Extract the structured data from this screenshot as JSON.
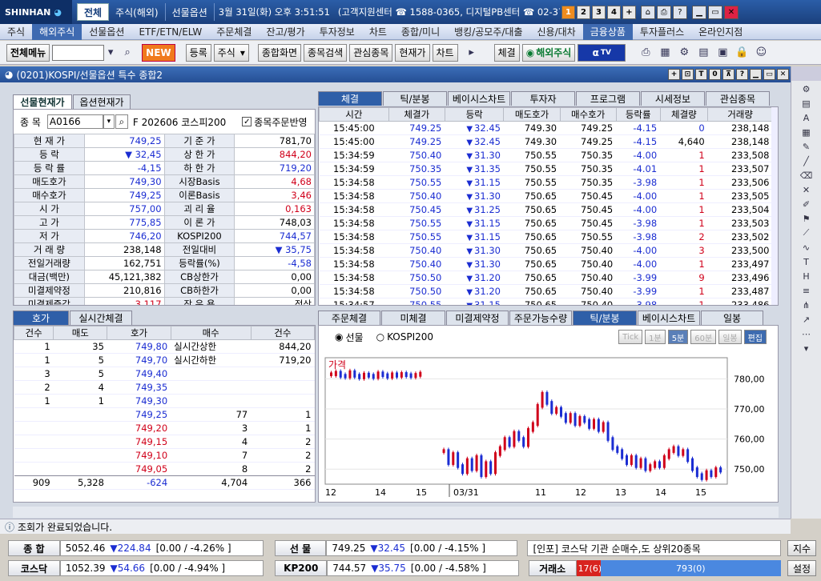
{
  "titlebar": {
    "logo": "SHINHAN",
    "tabs": [
      "전체",
      "주식(해외)",
      "선물옵션"
    ],
    "datetime": "3월 31일(화) 오후 3:51:51",
    "center": "(고객지원센터 ☎ 1588-0365, 디지털PB센터 ☎ 02-3772-",
    "nums": [
      "1",
      "2",
      "3",
      "4",
      "+"
    ]
  },
  "menu": [
    "주식",
    "해외주식",
    "선물옵션",
    "ETF/ETN/ELW",
    "주문체결",
    "잔고/평가",
    "투자정보",
    "차트",
    "종합/미니",
    "뱅킹/공모주/대출",
    "신용/대차",
    "금융상품",
    "투자플러스",
    "온라인지점"
  ],
  "toolbar": {
    "allmenu": "전체메뉴",
    "new": "NEW",
    "register": "등록",
    "type": "주식",
    "b1": "종합화면",
    "b2": "종목검색",
    "b3": "관심종목",
    "b4": "현재가",
    "b5": "차트",
    "b6": "체결",
    "overseas": "해외주식",
    "tv": "TV"
  },
  "window": {
    "title": "(0201)KOSPI/선물옵션 특수 종합2"
  },
  "left": {
    "tabs": [
      "선물현재가",
      "옵션현재가"
    ],
    "code_label": "종 목",
    "code": "A0166",
    "desc": "F 202606 코스피200",
    "check_label": "종목주문반영",
    "rows": [
      {
        "l1": "현 재 가",
        "v1": "749,25",
        "l2": "기 준 가",
        "v2": "781,70"
      },
      {
        "l1": "등    락",
        "v1": "32,45",
        "l2": "상 한 가",
        "v2": "844,20"
      },
      {
        "l1": "등 락 률",
        "v1": "-4,15",
        "l2": "하 한 가",
        "v2": "719,20"
      },
      {
        "l1": "매도호가",
        "v1": "749,30",
        "l2": "시장Basis",
        "v2": "4,68"
      },
      {
        "l1": "매수호가",
        "v1": "749,25",
        "l2": "이론Basis",
        "v2": "3,46"
      },
      {
        "l1": "시    가",
        "v1": "757,00",
        "l2": "괴 리 율",
        "v2": "0,163"
      },
      {
        "l1": "고    가",
        "v1": "775,85",
        "l2": "이 론 가",
        "v2": "748,03"
      },
      {
        "l1": "저    가",
        "v1": "746,20",
        "l2": "KOSPI200",
        "v2": "744,57"
      },
      {
        "l1": "거 래 량",
        "v1": "238,148",
        "l2": "전일대비",
        "v2": "35,75"
      },
      {
        "l1": "전일거래량",
        "v1": "162,751",
        "l2": "등락률(%)",
        "v2": "-4,58"
      },
      {
        "l1": "대금(백만)",
        "v1": "45,121,382",
        "l2": "CB상한가",
        "v2": "0,00"
      },
      {
        "l1": "미결제약정",
        "v1": "210,816",
        "l2": "CB하한가",
        "v2": "0,00"
      },
      {
        "l1": "미결제증감",
        "v1": "3,117",
        "l2": "장 운 용",
        "v2": "정상"
      }
    ]
  },
  "trades": {
    "tabs": [
      "체결",
      "틱/분봉",
      "베이시스차트",
      "투자자",
      "프로그램",
      "시세정보",
      "관심종목"
    ],
    "headers": [
      "시간",
      "체결가",
      "등락",
      "매도호가",
      "매수호가",
      "등락률",
      "체결량",
      "거래량"
    ],
    "rows": [
      [
        "15:45:00",
        "749.25",
        "32.45",
        "749.30",
        "749.25",
        "-4.15",
        "0",
        "238,148"
      ],
      [
        "15:45:00",
        "749.25",
        "32.45",
        "749.30",
        "749.25",
        "-4.15",
        "4,640",
        "238,148"
      ],
      [
        "15:34:59",
        "750.40",
        "31.30",
        "750.55",
        "750.35",
        "-4.00",
        "1",
        "233,508"
      ],
      [
        "15:34:59",
        "750.35",
        "31.35",
        "750.55",
        "750.35",
        "-4.01",
        "1",
        "233,507"
      ],
      [
        "15:34:58",
        "750.55",
        "31.15",
        "750.55",
        "750.35",
        "-3.98",
        "1",
        "233,506"
      ],
      [
        "15:34:58",
        "750.40",
        "31.30",
        "750.65",
        "750.45",
        "-4.00",
        "1",
        "233,505"
      ],
      [
        "15:34:58",
        "750.45",
        "31.25",
        "750.65",
        "750.45",
        "-4.00",
        "1",
        "233,504"
      ],
      [
        "15:34:58",
        "750.55",
        "31.15",
        "750.65",
        "750.45",
        "-3.98",
        "1",
        "233,503"
      ],
      [
        "15:34:58",
        "750.55",
        "31.15",
        "750.65",
        "750.55",
        "-3.98",
        "2",
        "233,502"
      ],
      [
        "15:34:58",
        "750.40",
        "31.30",
        "750.65",
        "750.40",
        "-4.00",
        "3",
        "233,500"
      ],
      [
        "15:34:58",
        "750.40",
        "31.30",
        "750.65",
        "750.40",
        "-4.00",
        "1",
        "233,497"
      ],
      [
        "15:34:58",
        "750.50",
        "31.20",
        "750.65",
        "750.40",
        "-3.99",
        "9",
        "233,496"
      ],
      [
        "15:34:58",
        "750.50",
        "31.20",
        "750.65",
        "750.40",
        "-3.99",
        "1",
        "233,487"
      ],
      [
        "15:34:57",
        "750.55",
        "31.15",
        "750.65",
        "750.40",
        "-3.98",
        "1",
        "233,486"
      ]
    ]
  },
  "orderbook": {
    "tabs": [
      "호가",
      "실시간체결"
    ],
    "headers": [
      "건수",
      "매도",
      "호가",
      "매수",
      "건수"
    ],
    "asks": [
      [
        "1",
        "35",
        "749,80"
      ],
      [
        "1",
        "5",
        "749,70"
      ],
      [
        "3",
        "5",
        "749,40"
      ],
      [
        "2",
        "4",
        "749,35"
      ],
      [
        "1",
        "1",
        "749,30"
      ]
    ],
    "bids": [
      [
        "749,25",
        "77",
        "1"
      ],
      [
        "749,20",
        "3",
        "1"
      ],
      [
        "749,15",
        "4",
        "2"
      ],
      [
        "749,10",
        "7",
        "2"
      ],
      [
        "749,05",
        "8",
        "2"
      ]
    ],
    "upper_label": "실시간상한",
    "upper": "844,20",
    "lower_label": "실시간하한",
    "lower": "719,20",
    "totals": [
      "909",
      "5,328",
      "-624",
      "4,704",
      "366"
    ]
  },
  "chart": {
    "tabs": [
      "주문체결",
      "미체결",
      "미결제약정",
      "주문가능수량",
      "틱/분봉",
      "베이시스차트",
      "일봉"
    ],
    "radio": [
      "선물",
      "KOSPI200"
    ],
    "periods": [
      "Tick",
      "1분",
      "5분",
      "60분",
      "일봉",
      "편집"
    ],
    "price_label": "가격",
    "xlabels": [
      "12",
      "14",
      "15",
      "03/31",
      "11",
      "12",
      "13",
      "14",
      "15"
    ]
  },
  "chart_data": {
    "type": "line",
    "ylim": [
      745,
      787
    ],
    "yticks": [
      "780,00",
      "770,00",
      "760,00",
      "750,00"
    ],
    "y": [
      781.5,
      782.0,
      781.0,
      780.8,
      782.2,
      781.0,
      780.5,
      781.4,
      781.0,
      780.6,
      781.8,
      781.2,
      780.7,
      781.5,
      781.0,
      781.6,
      781.2,
      780.9,
      781.3,
      781.7,
      null,
      null,
      null,
      null,
      756.0,
      752.0,
      755.0,
      751.0,
      749.0,
      753.0,
      750.0,
      754.0,
      748.0,
      752.0,
      749.0,
      755.0,
      757.0,
      760.0,
      758.0,
      762.0,
      760.0,
      758.0,
      763.0,
      765.0,
      771.0,
      775.0,
      772.0,
      769.0,
      770.0,
      768.0,
      766.0,
      768.0,
      765.0,
      767.0,
      766.0,
      764.0,
      766.0,
      763.0,
      765.0,
      760.0,
      757.0,
      756.0,
      754.0,
      752.0,
      754.0,
      751.0,
      753.0,
      750.0,
      751.0,
      752.0,
      751.0,
      754.0,
      756.0,
      757.0,
      755.0,
      756.0,
      753.0,
      750.0,
      748.0,
      747.0,
      749.0,
      748.0,
      750.0,
      749.5
    ]
  },
  "status": {
    "text": "조회가 완료되었습니다."
  },
  "bottom": {
    "r1": [
      {
        "label": "종  합",
        "val": "5052.46",
        "chg": "▼224.84",
        "pct": "[0.00  / -4.26% ]"
      },
      {
        "label": "선  물",
        "val": "749.25",
        "chg": "▼32.45",
        "pct": "[0.00  / -4.15% ]"
      }
    ],
    "news": "[인포] 코스닥 기관 순매수,도 상위20종목",
    "news_btn": "지수",
    "r2": [
      {
        "label": "코스닥",
        "val": "1052.39",
        "chg": "▼54.66",
        "pct": "[0.00  / -4.94% ]"
      },
      {
        "label": "KP200",
        "val": "744.57",
        "chg": "▼35.75",
        "pct": "[0.00  / -4.58% ]"
      }
    ],
    "trade_label": "거래소",
    "bar_a": "17(6)",
    "bar_b": "793(0)",
    "settings": "설정"
  },
  "colors": {
    "up": "#d0001a",
    "down": "#1b2dd2",
    "accent": "#2f5fa8"
  }
}
